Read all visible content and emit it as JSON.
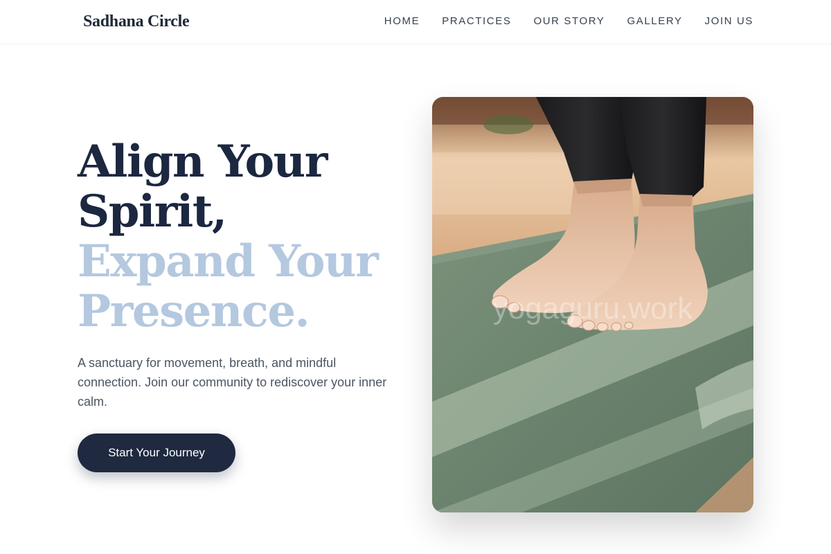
{
  "header": {
    "logo": "Sadhana Circle",
    "nav": [
      "HOME",
      "PRACTICES",
      "OUR STORY",
      "GALLERY",
      "JOIN US"
    ]
  },
  "hero": {
    "title_line_1": "Align Your",
    "title_line_2": "Spirit,",
    "title_line_3": "Expand Your",
    "title_line_4": "Presence.",
    "subtitle": "A sanctuary for movement, breath, and mindful connection. Join our community to rediscover your inner calm.",
    "cta_label": "Start Your Journey",
    "image_watermark": "yogaguru.work"
  },
  "colors": {
    "primary_dark": "#1c2740",
    "accent_light": "#b4c8df",
    "mat_green": "#6b836e"
  }
}
